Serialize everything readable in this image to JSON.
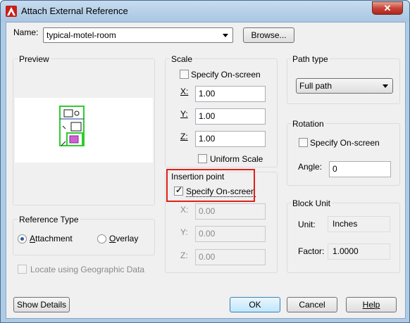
{
  "window": {
    "title": "Attach External Reference",
    "close_label": "✕"
  },
  "name": {
    "label": "Name:",
    "value": "typical-motel-room",
    "browse_label": "Browse..."
  },
  "preview": {
    "title": "Preview"
  },
  "scale": {
    "title": "Scale",
    "specify_onscreen": "Specify On-screen",
    "x_label": "X:",
    "x_value": "1.00",
    "y_label": "Y:",
    "y_value": "1.00",
    "z_label": "Z:",
    "z_value": "1.00",
    "uniform": "Uniform Scale"
  },
  "insertion": {
    "title": "Insertion point",
    "specify_onscreen": "Specify On-screen",
    "x_label": "X:",
    "x_value": "0.00",
    "y_label": "Y:",
    "y_value": "0.00",
    "z_label": "Z:",
    "z_value": "0.00"
  },
  "path_type": {
    "title": "Path type",
    "value": "Full path"
  },
  "rotation": {
    "title": "Rotation",
    "specify_onscreen": "Specify On-screen",
    "angle_label": "Angle:",
    "angle_value": "0"
  },
  "block_unit": {
    "title": "Block Unit",
    "unit_label": "Unit:",
    "unit_value": "Inches",
    "factor_label": "Factor:",
    "factor_value": "1.0000"
  },
  "reference_type": {
    "title": "Reference Type",
    "attachment": "Attachment",
    "overlay": "Overlay"
  },
  "geographic": {
    "label": "Locate using Geographic Data"
  },
  "buttons": {
    "show_details": "Show Details",
    "ok": "OK",
    "cancel": "Cancel",
    "help": "Help"
  }
}
